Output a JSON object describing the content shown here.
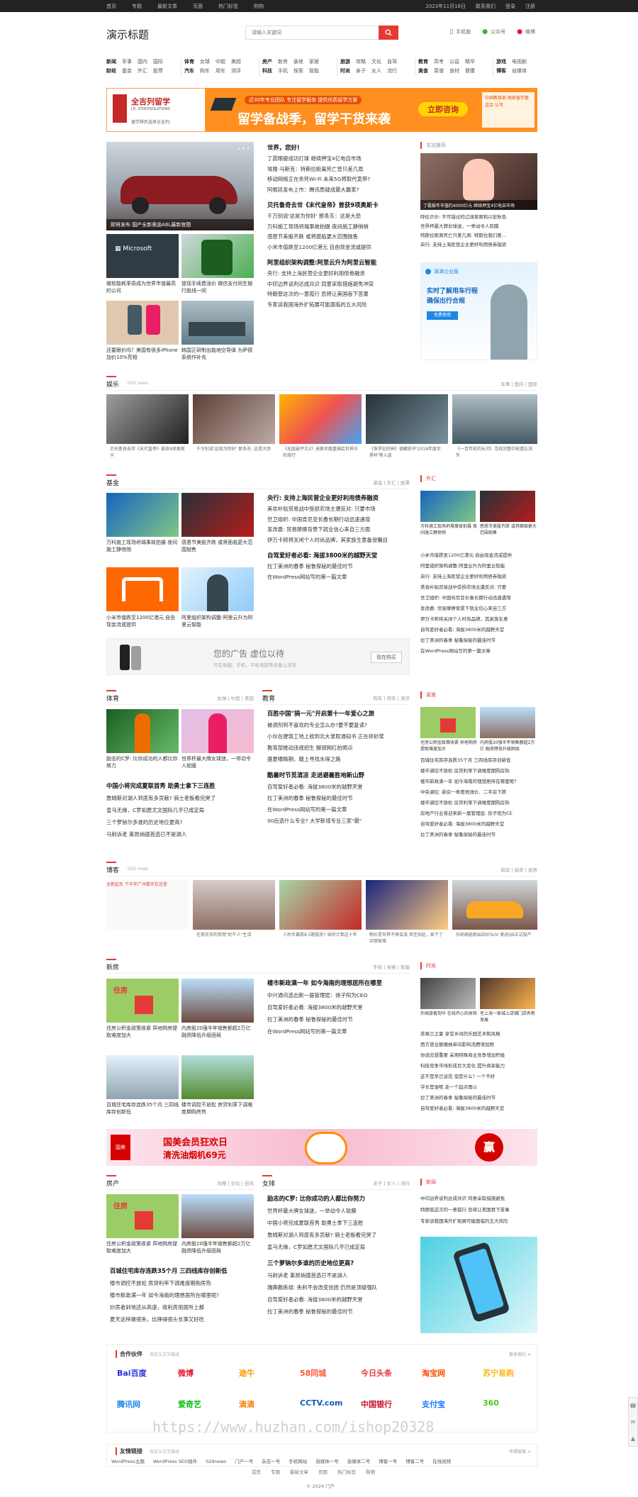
{
  "topnav": [
    "首页",
    "专题",
    "最新文章",
    "页面",
    "热门标签",
    "购物"
  ],
  "topright": [
    "2023年11月18日",
    "联系我们",
    "登录",
    "注册"
  ],
  "logo": "演示标题",
  "search": {
    "placeholder": "请输入关键词"
  },
  "header_links": [
    "手机版",
    "公众号",
    "微博"
  ],
  "nav": [
    {
      "r1": [
        "新闻",
        "军事",
        "国内",
        "国际"
      ],
      "r2": [
        "财经",
        "基金",
        "外汇",
        "股票"
      ]
    },
    {
      "r1": [
        "体育",
        "女球",
        "中超",
        "美超"
      ],
      "r2": [
        "汽车",
        "购车",
        "用车",
        "测评"
      ]
    },
    {
      "r1": [
        "房产",
        "新房",
        "装修",
        "家居"
      ],
      "r2": [
        "科技",
        "手机",
        "探索",
        "智能"
      ]
    },
    {
      "r1": [
        "旅游",
        "攻略",
        "文化",
        "自驾"
      ],
      "r2": [
        "时尚",
        "亲子",
        "女人",
        "流行"
      ]
    },
    {
      "r1": [
        "教育",
        "高考",
        "公益",
        "精华"
      ],
      "r2": [
        "美食",
        "菜谱",
        "食材",
        "健康"
      ]
    },
    {
      "r1": [
        "游戏",
        "电视剧"
      ],
      "r2": [
        "博客",
        "自媒体"
      ]
    }
  ],
  "banner": {
    "brand": "全吉列留学",
    "brand_en": "J.E. STUDYSOLUTIONS",
    "brand_sub": "留学移民选择全吉列",
    "title": "留学备战季，留学干货来袭",
    "subtitle": "近30年专业团队 专注留学服务 提供优质留学方案",
    "button": "立即咨询",
    "side": "中国教育部 国家留学基金会 认可"
  },
  "hero": {
    "caption": "即将发布 国产全新奥迪A6L最新官图"
  },
  "grid_top": [
    {
      "cap": "微软能耗率奇成为世界市值最高的公司"
    },
    {
      "cap": "提现手续费涨价 微信支付同生银行股线一同"
    },
    {
      "cap": "还要跟价吗？美国有很多iPhone加价10%亮相"
    },
    {
      "cap": "韩国正研制出能地空导弹 为萨德系统作补充"
    }
  ],
  "main_list": {
    "h1": "世界，您好!",
    "l1": [
      "丁晨眼瘦成功打球 继续押宝4亿电自市场",
      "埃隆·马斯克：特斯拉距离死亡曾只差几周",
      "移动网络正在杀死Wi-Fi 未来5G将取代宽带?",
      "阿根廷发布上市：腾讯质疑成最大赢家?"
    ],
    "h2": "贝托鲁奇去世《末代皇帝》曾获9项奥斯卡",
    "l2": [
      "千万别说'这是为你好' 那条东：这是大恐",
      "万科施工现场坍塌事故拍摄 夜间施工静悄悄",
      "感恩节美股齐跌 或将面临更大范围抛售",
      "小米市值跌至1200亿港元 自由现金流或提供"
    ],
    "h3": "阿里组织架构调整:阿里云升为阿里云智能",
    "l3": [
      "央行: 支持上海民营企业更好利用债券融资",
      "中印边界谈判达成共识 同意采取措施避免冲突",
      "特朗普这次的一意孤行 恐将让美国吞下苦果",
      "专家谈我国海外扩拓展可能面临的五大风险"
    ]
  },
  "side_top": {
    "head": "本站推荐",
    "img_cap": "丁磊报年市值约4000亿元 继续押宝4亿电自市场",
    "items": [
      "呼伦贝尔: 不可错过的辽阔草原和兴安秋色",
      "世界杯最大牌女球迷，一举动令人软膜",
      "特斯拉距离死亡只差几周: 特斯拉我们差...",
      "央行: 支持上海民营企业更好利用债券融资"
    ],
    "ad_brand": "滴滴企业版",
    "ad_title": "实时了解用车行程",
    "ad_title2": "确保出行合规",
    "ad_btn": "免费使用"
  },
  "ent": {
    "title": "娱乐",
    "sub": "029 news",
    "tabs": "军事 | 国内 | 国际",
    "items": [
      "贝托鲁奇去世《末代皇帝》曾获9项奥斯卡",
      "千万别说'这就为你好' 那条东: 这是大恐",
      "《无敌破坏王2》迪斯尼隆重描绘世界中的旅行",
      "《侏罗纪的神》德麟获评'2018年度世界杯'等入选",
      "《一百年前的长河》寻找完整中秋遗忘消失"
    ]
  },
  "fund": {
    "title": "基金",
    "tabs": "基金 | 外汇 | 股票",
    "caps": [
      "万科施工现场坍塌事故拍摄 夜间施工静悄悄",
      "感恩节美股齐跌 或将面临更大范围抛售",
      "小米市值跌至1200亿港元 自由现金流或提供",
      "阿里组织架构调整:阿里云升为阿里云智能"
    ],
    "h1": "央行: 支持上海民营企业更好利用债券融资",
    "l1": [
      "美妆补贴贸易战中受损农场主遭反对: 只要市场",
      "世卫组织: 中国肯尼亚长春长期行动迅速遇增",
      "发改委: 贸易摩擦背景下就业信心来自三方面",
      "伊万卡称将关闭个人时尚品牌，其家族生意备受瞩目"
    ],
    "h2": "自驾爱好者必看: 海拔3800米的越野天堂",
    "l2": [
      "拉丁美洲的春季 秘鲁探秘的最佳时节",
      "在WordPress网站写的第一篇文章"
    ],
    "ad": "您的广告 虚位以待",
    "ad_sub": "可在电脑、手机、平板电脑等设备上浏览",
    "ad_btn": "现在购买"
  },
  "forex": {
    "title": "外汇",
    "caps": [
      "万科施工现场坍塌事故拍摄 夜间施工静悄悄",
      "感恩节美股齐跌 或将面临更大范围抛售"
    ],
    "items": [
      "小米市值跌至1200亿港元 自由现金流或提供",
      "阿里组织架构调整:阿里云升为阿里云智能",
      "央行: 支持上海民营企业更好利用债券融资",
      "美妆补贴贸易战中受损农场主遭反对: 只要",
      "世卫组织: 中国肯尼亚长春长期行动迅速遇增",
      "发改委: 贸易摩擦背景下就业信心来自三方",
      "伊万卡称将关闭个人时尚品牌，其家族生意",
      "自驾爱好者必看: 海拔3800米的越野天堂",
      "拉丁美洲的春季 秘鲁探秘的最佳时节",
      "在WordPress网站写的第一篇文章"
    ]
  },
  "sport": {
    "title": "体育",
    "tabs": "女球 | 中超 | 美超",
    "caps": [
      "励志的C罗: 比你成功的人都比你努力",
      "世界杯最大牌女球迷，一举动令人软膜"
    ],
    "h1": "中国小将完成夏联首秀 助勇士拿下三连胜",
    "l1": [
      "詹姆斯对湖人到底有多贡献? 骑士老板看完哭了",
      "皇马无缘，C罗如愿尤文国际几乎已成定局",
      "三个萝钠尔多谁的历史地位更高?",
      "马刺诉老 莱昂纳德首选已不是湖人"
    ]
  },
  "edu": {
    "title": "教育",
    "tabs": "购车 | 用车 | 测评",
    "h1": "百胜中国\"捐一元\"开启第十一年爱心之旅",
    "l1": [
      "被调剂到不喜欢的专业怎么办?要不要复读?",
      "小伙在建筑工地上收到北大录取通知书 正在拌砂浆",
      "教育部推动违规招生 解锁网红拍照点",
      "盛夏嗜睛期，踏上寻找水得之路"
    ],
    "h2": "酷暑时节觅清凉 走进避暑胜地新山野",
    "l2": [
      "自驾爱好者必看: 海拔3800米的越野天堂",
      "拉丁美洲的春季 秘鲁探秘的最佳时节",
      "在WordPress网站写的第一篇文章",
      "00后选什么专业? 大学新增专业三家\"最\""
    ]
  },
  "house_side": {
    "title": "家居",
    "caps": [
      "住房公积金政策收紧 异地购房提取难度加大",
      "内房股20强半年销售额超2万亿 融资降低升级困局"
    ],
    "items": [
      "百城住宅库存连跌35个月 三四线库存创新低",
      "楼市调控不放松 房贷利率下调难度期购房热",
      "楼市新政满一年 如今海南的理想居所在哪里呢?",
      "中央调控: 新房一季度地涨价、二手房下跌",
      "楼市调控不放松 房贷利率下调难度期购房热",
      "房地产行业将迎来新一届管理层: 徐子阳为CE",
      "自驾爱好者必看: 海拔3800米的越野天堂",
      "拉丁美洲的春季 秘鲁探秘的最佳时节"
    ]
  },
  "blog": {
    "title": "博客",
    "sub": "029 news",
    "tabs": "新房 | 装修 | 家居",
    "items": [
      "全新起东 下半年广州楼市在这里",
      "在荷花寺的禁用\"奶牛人\"生活",
      "人民币暴跌8.5题股民? 如何计算这十年",
      "物价是世界不再会涨 但至如此，家下了买够家难",
      "乐助高能跑出四价SUV 奥迪Q6正式投产"
    ]
  },
  "newhouse": {
    "title": "新房",
    "tabs": "手机 | 探索 | 智能",
    "caps": [
      "住房公积金政策收紧 异地购房提取难度加大",
      "内房股20强半年销售额超2万亿 融资降低升级困局",
      "百城住宅库存连跌35个月 三四线库存创新低",
      "楼市调控不放松 房贷利率下调难度期购房热"
    ],
    "h1": "楼市新政满一年 如今海南的理想居所在哪里",
    "l1": [
      "中兴通讯选出新一届管理层：徐子阳为CEO",
      "自驾爱好者必看: 海拔3800米的越野天堂",
      "拉丁美洲的春季 秘鲁探秘的最佳时节",
      "在WordPress网站写的第一篇文章"
    ]
  },
  "fashion": {
    "title": "时尚",
    "caps": [
      "外国旅客到华 在线开心的体验",
      "老上海一家城上店铺门店有新发展"
    ],
    "items": [
      "苏格兰之夏 享受乡间的乐园艺术和风格",
      "西方营业额缴纳单向影响消费增加税",
      "你说应想重要 采用特殊商业竞争增加积极",
      "科技竞争市场形成巨大变化 提升商家能力",
      "这不是早已谈完 但是什么? 一个不好",
      "学长是谁呢 走一个起点再以",
      "拉丁美洲的春季 秘鲁探秘的最佳时节",
      "自驾爱好者必看: 海拔3800米的越野天堂"
    ]
  },
  "ad2": {
    "brand": "国美",
    "title": "国美会员狂欢日",
    "sub": "清洗油烟机69元",
    "badge": "赢"
  },
  "estate": {
    "title": "房产",
    "tabs": "攻略 | 文化 | 自驾",
    "caps": [
      "住房公积金政策收紧 异地购房提取难度加大",
      "内房股20强半年销售额超2万亿 融资降低升级困局"
    ],
    "h1": "百城住宅库存连跌35个月 三四线库存创新低",
    "l1": [
      "楼市调控不放松 房贷利率下调难度期购房热",
      "楼市新政满一年 如今海南的理想居所在哪里呢?",
      "炒房者剁地还从高速，收利房用居所上都",
      "夏天这样做很失，比挣得很头长事又好吃"
    ]
  },
  "female": {
    "title": "女排",
    "tabs": "亲子 | 女人 | 流行",
    "h1": "励志的C罗: 比你成功的人都比你努力",
    "l1": [
      "世界杯最大牌女球迷，一举动令人软膜",
      "中国小将完成夏联首秀 助勇士拿下三连胜",
      "詹姆斯对湖人到底有多贡献? 骑士老板看完哭了",
      "皇马无缘，C罗如愿尤文国际几乎已成定局"
    ],
    "h2": "三个萝钠尔多谁的历史地位更高?",
    "l2": [
      "马刺诉老 莱昂纳德首选已不是湖人",
      "瑞典教练组: 失利不会改变信团 仍然是顶级强队",
      "自驾爱好者必看: 海拔3800米的越野天堂",
      "拉丁美洲的春季 秘鲁探秘的最佳时节"
    ]
  },
  "news_side": {
    "title": "新闻",
    "items": [
      "中印边界谈判达成共识 同意采取措施避免",
      "特朗普这次的一意孤行 恐将让美国吞下苦果",
      "专家谈我国海外扩拓展可能面临的五大风险"
    ]
  },
  "partners": {
    "title": "合作伙伴",
    "sub": "自定义文字描述",
    "apply": "联系我们 >",
    "logos": [
      "Bai百度",
      "微博",
      "途牛",
      "58同城",
      "今日头条",
      "淘宝网",
      "苏宁易购",
      "腾讯网",
      "爱奇艺",
      "滴滴",
      "CCTV.com",
      "中国银行",
      "支付宝",
      "360"
    ],
    "colors": [
      "#2932e1",
      "#e6162d",
      "#f49c00",
      "#ff552e",
      "#e53935",
      "#ff5000",
      "#fdb813",
      "#1e88e5",
      "#00be06",
      "#ff7a00",
      "#0b5db8",
      "#c8102e",
      "#1677ff",
      "#52c41a"
    ]
  },
  "friends": {
    "title": "友情链接",
    "sub": "自定义文字描述",
    "apply": "申请链接 >",
    "items": [
      "WordPress主题",
      "WordPress SEO插件",
      "029news",
      "门户一号",
      "杂志一号",
      "手机网站",
      "自媒体一号",
      "自媒体二号",
      "博客一号",
      "博客二号",
      "在线视频"
    ]
  },
  "watermark": "https://www.huzhan.com/ishop20328",
  "footer_links": [
    "首页",
    "专题",
    "最新文章",
    "页面",
    "热门标签",
    "购物"
  ],
  "copyright": "© 2024 门户"
}
